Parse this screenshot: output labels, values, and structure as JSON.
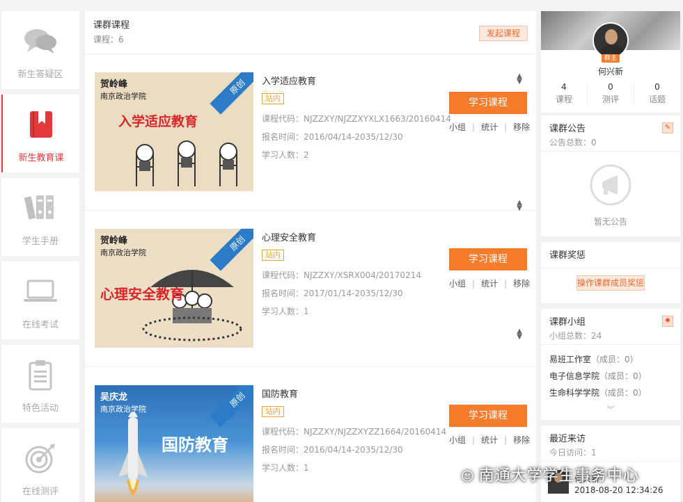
{
  "sidebar": {
    "items": [
      {
        "label": "新生答疑区",
        "icon": "chat-bubbles-icon",
        "active": false
      },
      {
        "label": "新生教育课",
        "icon": "bookmark-book-icon",
        "active": true
      },
      {
        "label": "学生手册",
        "icon": "binders-icon",
        "active": false
      },
      {
        "label": "在线考试",
        "icon": "laptop-icon",
        "active": false
      },
      {
        "label": "特色活动",
        "icon": "clipboard-icon",
        "active": false
      },
      {
        "label": "在线测评",
        "icon": "target-icon",
        "active": false
      }
    ]
  },
  "main": {
    "title": "课群课程",
    "count": "课程：6",
    "start_button": "发起课程",
    "courses": [
      {
        "title": "入学适应教育",
        "tag": "站内",
        "code": "课程代码：NJZZXY/NJZZXYXLX1663/20160414",
        "period": "报名时间：2016/04/14-2035/12/30",
        "learners": "学习人数：2",
        "thumb_teacher": "贺岭峰",
        "thumb_school": "南京政治学院",
        "thumb_ribbon": "原创",
        "thumb_text": "入学适应教育"
      },
      {
        "title": "心理安全教育",
        "tag": "站内",
        "code": "课程代码：NJZZXY/XSRX004/20170214",
        "period": "报名时间：2017/01/14-2035/12/30",
        "learners": "学习人数：1",
        "thumb_teacher": "贺岭峰",
        "thumb_school": "南京政治学院",
        "thumb_ribbon": "原创",
        "thumb_text": "心理安全教育"
      },
      {
        "title": "国防教育",
        "tag": "站内",
        "code": "课程代码：NJZZXY/NJZZXYZZ1664/20160414",
        "period": "报名时间：2016/04/14-2035/12/30",
        "learners": "学习人数：1",
        "thumb_teacher": "吴庆龙",
        "thumb_school": "南京政治学院",
        "thumb_ribbon": "原创",
        "thumb_text": "国防教育"
      }
    ],
    "learn_button": "学习课程",
    "ops": [
      "小组",
      "统计",
      "移除"
    ]
  },
  "profile": {
    "name": "何兴新",
    "badge": "群主",
    "stats": [
      {
        "num": "4",
        "label": "课程"
      },
      {
        "num": "0",
        "label": "测评"
      },
      {
        "num": "0",
        "label": "话题"
      }
    ]
  },
  "notice": {
    "title": "课群公告",
    "count": "公告总数：0",
    "empty": "暂无公告"
  },
  "rewards": {
    "title": "课群奖惩",
    "button": "操作课群成员奖惩"
  },
  "groups": {
    "title": "课群小组",
    "count": "小组总数：24",
    "items": [
      {
        "name": "易班工作室",
        "members": "（成员：0）"
      },
      {
        "name": "电子信息学院",
        "members": "（成员：0）"
      },
      {
        "name": "生命科学学院",
        "members": "（成员：0）"
      }
    ]
  },
  "visitors": {
    "title": "最近来访",
    "today": "今日访问：1",
    "visitor_name": "何兴新",
    "time": "2018-08-20 12:34:26"
  },
  "watermark": "南通大学学生事务中心",
  "colors": {
    "accent": "#f47c2c",
    "active": "#e4393c",
    "ribbon": "#2b7bc8"
  }
}
